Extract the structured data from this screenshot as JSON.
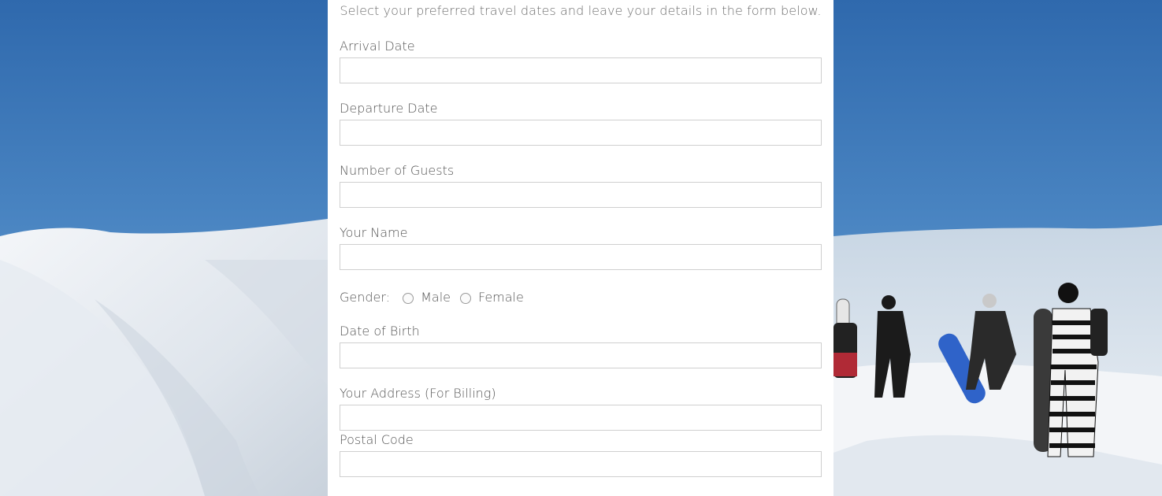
{
  "intro_text": "Select your preferred travel dates and leave your details in the form below.",
  "fields": {
    "arrival": {
      "label": "Arrival Date",
      "value": ""
    },
    "departure": {
      "label": "Departure Date",
      "value": ""
    },
    "guests": {
      "label": "Number of Guests",
      "value": ""
    },
    "name": {
      "label": "Your Name",
      "value": ""
    },
    "dob": {
      "label": "Date of Birth",
      "value": ""
    },
    "address": {
      "label": "Your Address (For Billing)",
      "value": ""
    },
    "postal": {
      "label": "Postal Code",
      "value": ""
    }
  },
  "gender": {
    "label": "Gender:",
    "options": [
      "Male",
      "Female"
    ]
  },
  "colors": {
    "sky": "#3f78b6",
    "snow": "#eef2f6",
    "panel": "#ffffff",
    "input_border": "#cfcfcf"
  }
}
